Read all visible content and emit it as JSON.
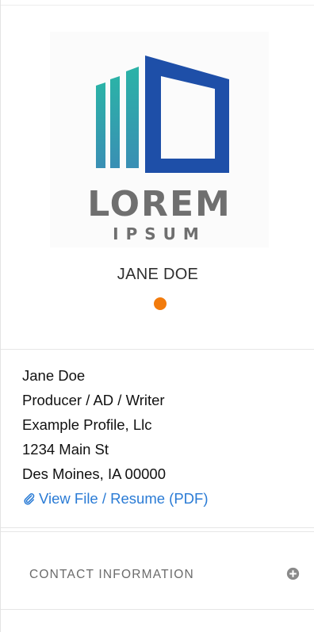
{
  "logo": {
    "word1": "LOREM",
    "word2": "IPSUM",
    "icon": "building-logo-icon",
    "colors": {
      "teal": "#3aa6a0",
      "blue": "#1e4fa8",
      "gray": "#6f6f6f"
    }
  },
  "profile": {
    "display_name": "JANE DOE",
    "status_color": "#f27b0c"
  },
  "details": {
    "name": "Jane Doe",
    "title": "Producer / AD / Writer",
    "company": "Example Profile, Llc",
    "address_line1": "1234 Main St",
    "address_line2": "Des Moines, IA 00000",
    "resume_link": "View File / Resume (PDF)",
    "resume_icon": "paperclip-icon",
    "link_color": "#2a7bd5"
  },
  "sections": {
    "contact": {
      "title": "CONTACT INFORMATION",
      "icon": "plus-circle-icon"
    }
  }
}
